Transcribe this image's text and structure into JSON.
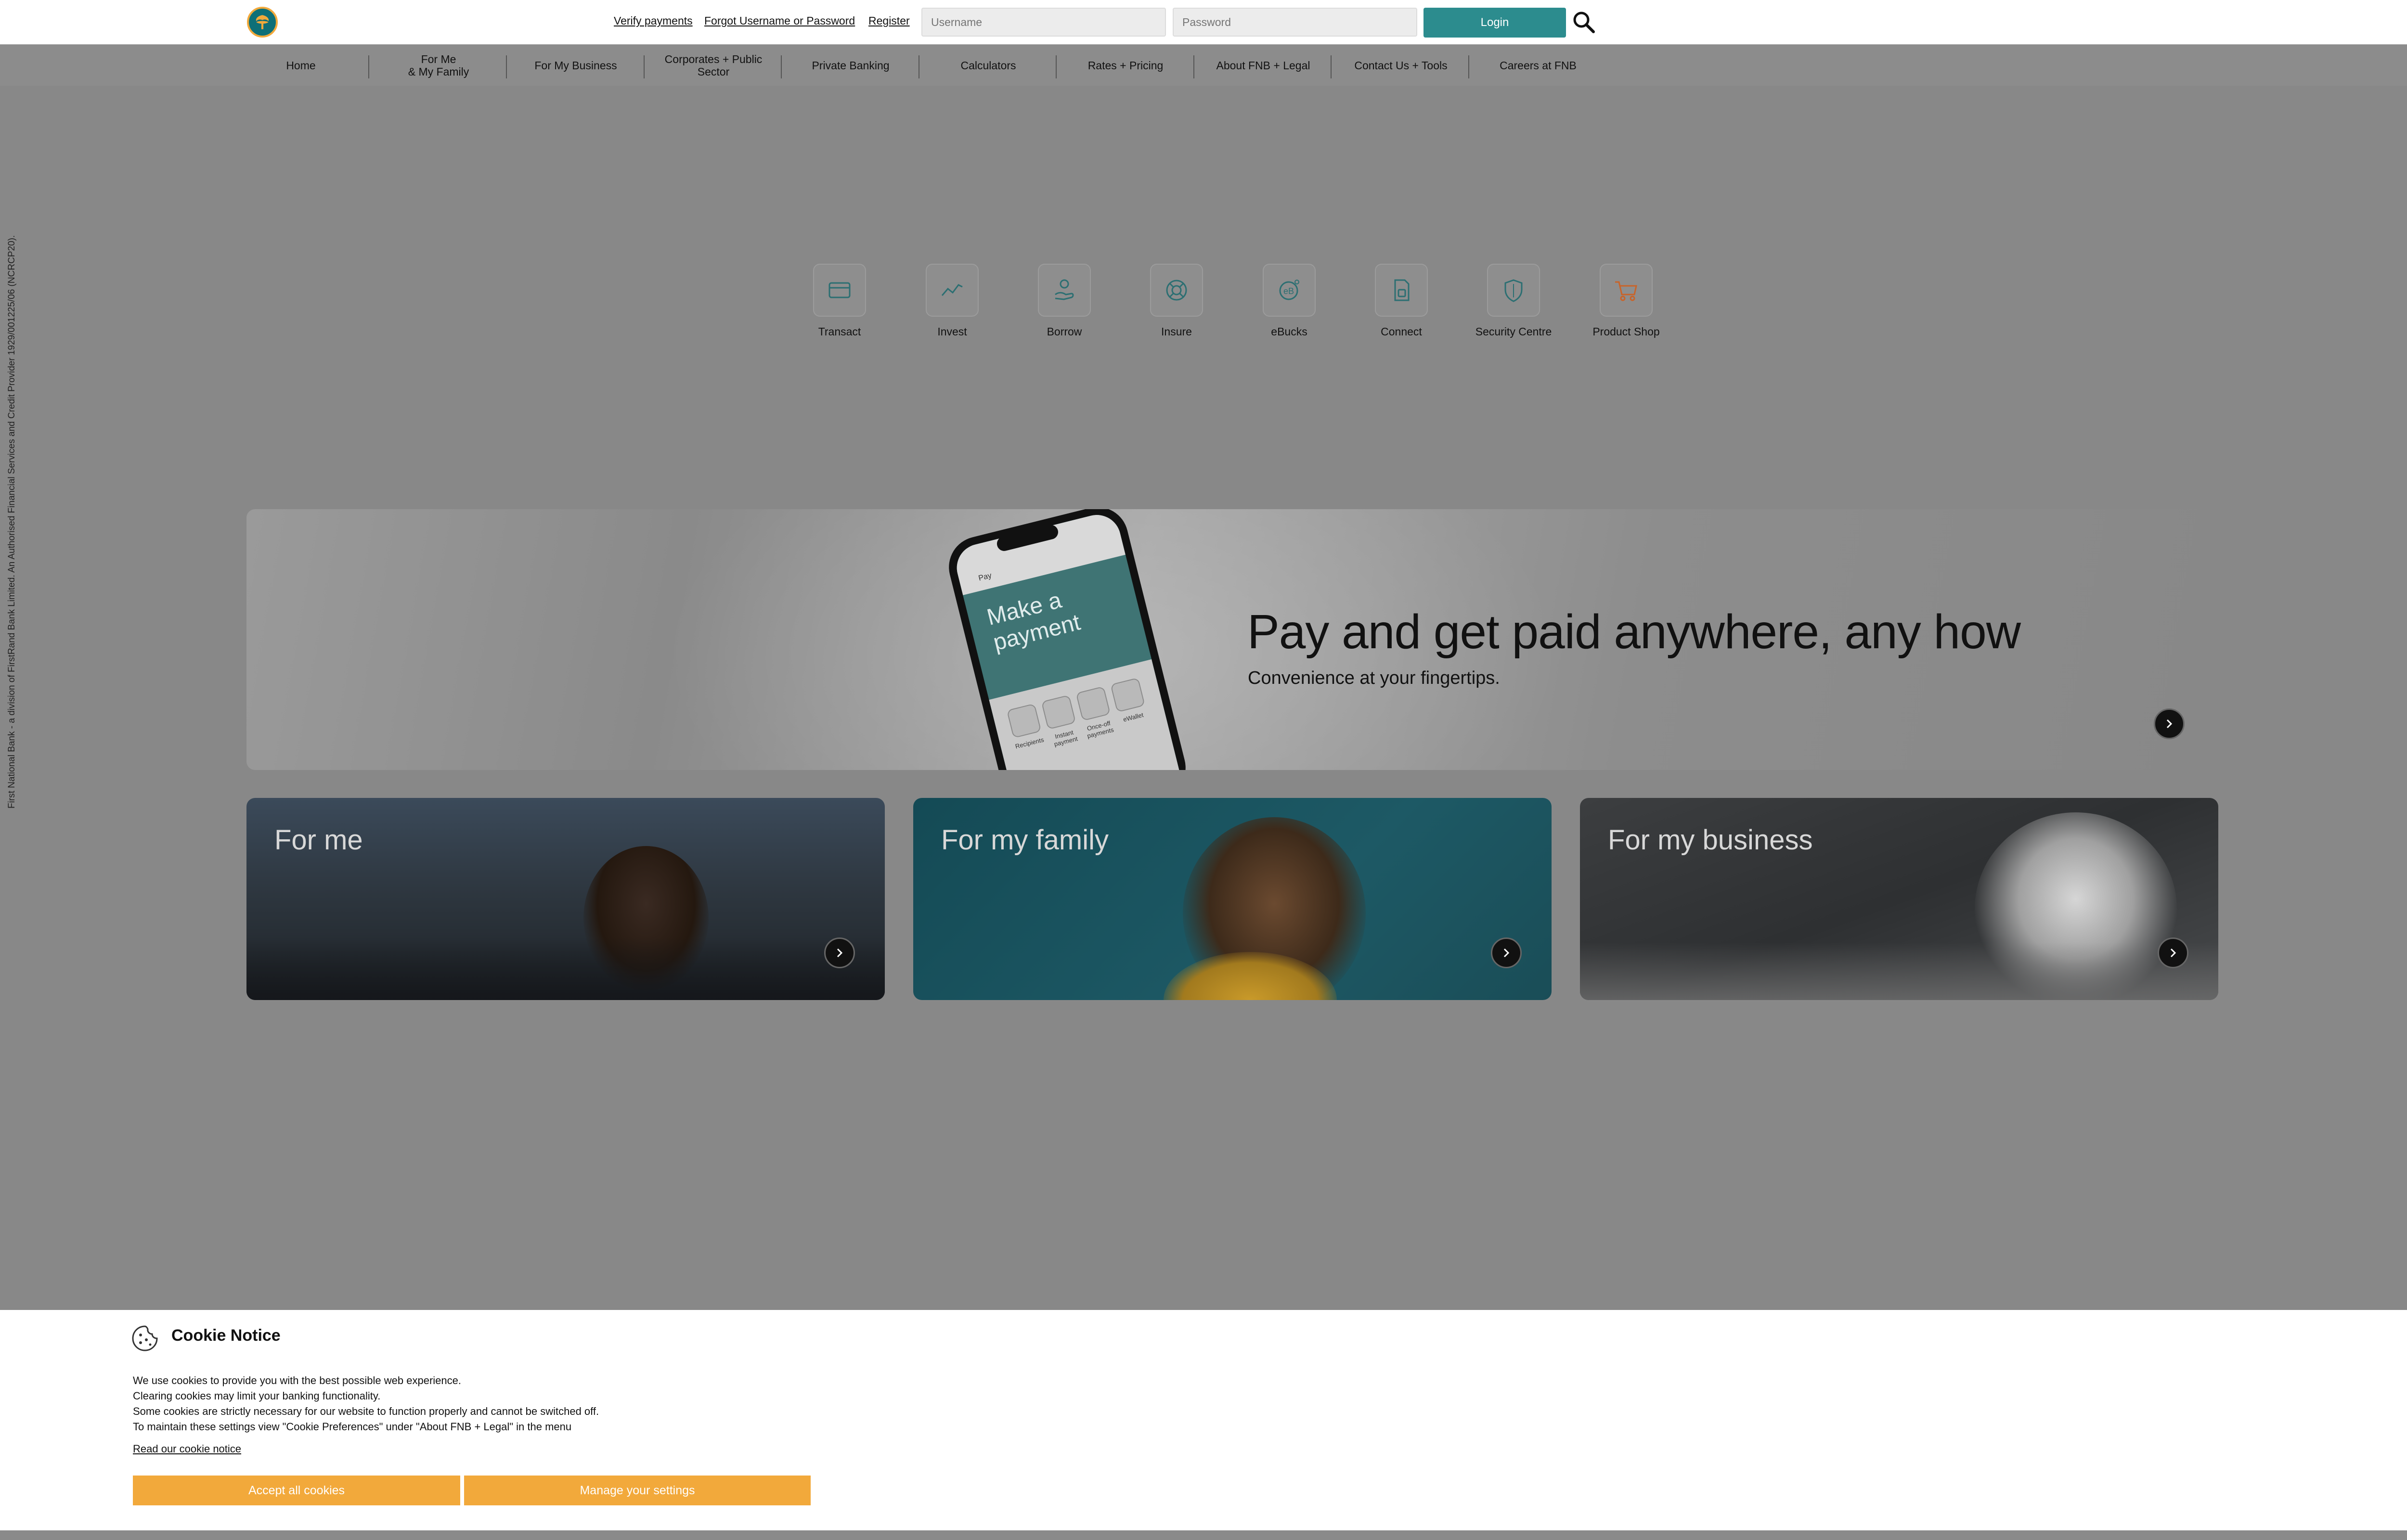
{
  "header": {
    "links": [
      "Verify payments",
      "Forgot Username or Password",
      "Register"
    ],
    "username_placeholder": "Username",
    "password_placeholder": "Password",
    "login_label": "Login"
  },
  "nav": {
    "items": [
      "Home",
      "For Me\n& My Family",
      "For My Business",
      "Corporates + Public\nSector",
      "Private Banking",
      "Calculators",
      "Rates + Pricing",
      "About FNB + Legal",
      "Contact Us + Tools",
      "Careers at FNB"
    ]
  },
  "quicklinks": [
    {
      "label": "Transact",
      "icon": "card-icon"
    },
    {
      "label": "Invest",
      "icon": "chart-line-icon"
    },
    {
      "label": "Borrow",
      "icon": "hand-coin-icon"
    },
    {
      "label": "Insure",
      "icon": "lifebuoy-icon"
    },
    {
      "label": "eBucks",
      "icon": "ebucks-icon"
    },
    {
      "label": "Connect",
      "icon": "sim-card-icon"
    },
    {
      "label": "Security Centre",
      "icon": "shield-icon"
    },
    {
      "label": "Product Shop",
      "icon": "cart-icon"
    }
  ],
  "legal_text": "First National Bank - a division of FirstRand Bank Limited. An Authorised Financial Services and Credit Provider 1929/001225/06 (NCRCP20).",
  "hero": {
    "title": "Pay and get paid anywhere, any how",
    "subtitle": "Convenience at your fingertips.",
    "phone": {
      "app_title": "Pay",
      "screen_text": "Make a payment",
      "tiles": [
        "Recipients",
        "Instant payment",
        "Once-off payments",
        "eWallet"
      ]
    }
  },
  "cards": [
    {
      "title": "For me"
    },
    {
      "title": "For my family"
    },
    {
      "title": "For my business"
    }
  ],
  "cookie": {
    "title": "Cookie Notice",
    "lines": [
      "We use cookies to provide you with the best possible web experience.",
      "Clearing cookies may limit your banking functionality.",
      "Some cookies are strictly necessary for our website to function properly and cannot be switched off.",
      "To maintain these settings view \"Cookie Preferences\" under \"About FNB + Legal\" in the menu"
    ],
    "link": "Read our cookie notice",
    "accept_label": "Accept all cookies",
    "manage_label": "Manage your settings"
  },
  "colors": {
    "accent_teal": "#2c8c8e",
    "cookie_orange": "#f2a93b",
    "overlay_grey": "#888888"
  }
}
